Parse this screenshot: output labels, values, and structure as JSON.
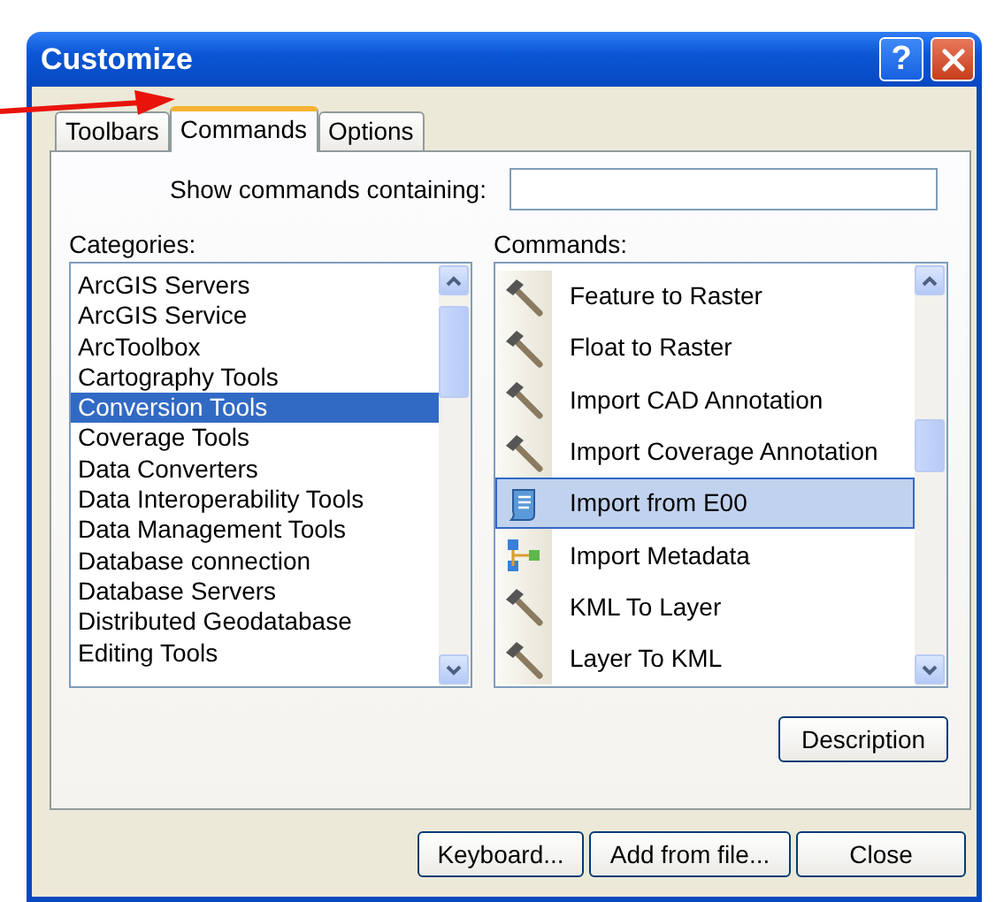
{
  "window": {
    "title": "Customize",
    "help_label": "?"
  },
  "tabs": [
    {
      "label": "Toolbars",
      "selected": false
    },
    {
      "label": "Commands",
      "selected": true
    },
    {
      "label": "Options",
      "selected": false
    }
  ],
  "search": {
    "label": "Show commands containing:"
  },
  "categories": {
    "label": "Categories:",
    "items": [
      {
        "label": "ArcGIS Servers",
        "selected": false
      },
      {
        "label": "ArcGIS Service",
        "selected": false
      },
      {
        "label": "ArcToolbox",
        "selected": false
      },
      {
        "label": "Cartography Tools",
        "selected": false
      },
      {
        "label": "Conversion Tools",
        "selected": true
      },
      {
        "label": "Coverage Tools",
        "selected": false
      },
      {
        "label": "Data Converters",
        "selected": false
      },
      {
        "label": "Data Interoperability Tools",
        "selected": false
      },
      {
        "label": "Data Management Tools",
        "selected": false
      },
      {
        "label": "Database connection",
        "selected": false
      },
      {
        "label": "Database Servers",
        "selected": false
      },
      {
        "label": "Distributed Geodatabase",
        "selected": false
      },
      {
        "label": "Editing Tools",
        "selected": false
      }
    ]
  },
  "commands": {
    "label": "Commands:",
    "items": [
      {
        "label": "Feature to Raster",
        "kind": "tool",
        "selected": false
      },
      {
        "label": "Float to Raster",
        "kind": "tool",
        "selected": false
      },
      {
        "label": "Import CAD Annotation",
        "kind": "tool",
        "selected": false
      },
      {
        "label": "Import Coverage Annotation",
        "kind": "tool",
        "selected": false
      },
      {
        "label": "Import from E00",
        "kind": "script",
        "selected": true
      },
      {
        "label": "Import Metadata",
        "kind": "model",
        "selected": false
      },
      {
        "label": "KML To Layer",
        "kind": "tool",
        "selected": false
      },
      {
        "label": "Layer To KML",
        "kind": "tool",
        "selected": false
      }
    ]
  },
  "description_button": "Description",
  "buttons": [
    "Keyboard...",
    "Add from file...",
    "Close"
  ]
}
